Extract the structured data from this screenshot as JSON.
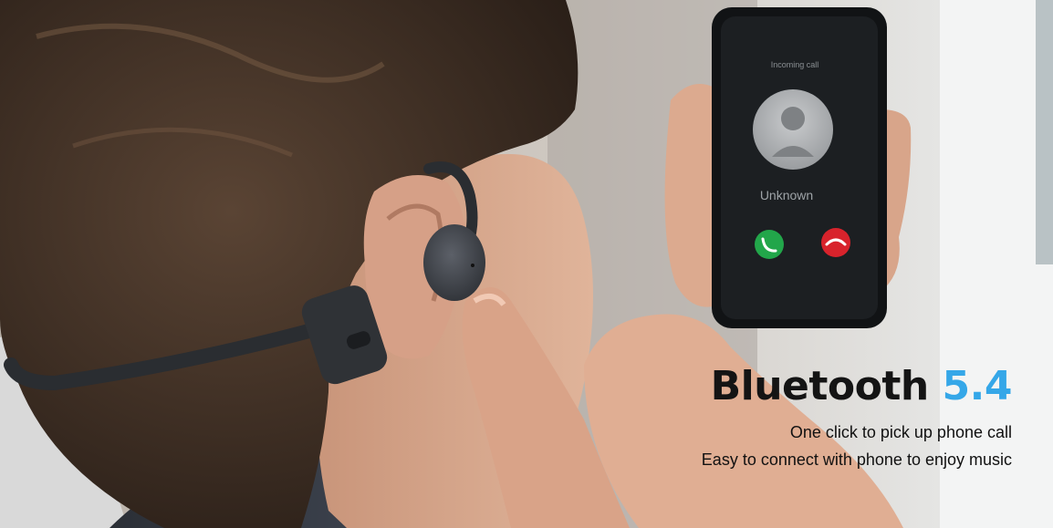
{
  "hero": {
    "title_word": "Bluetooth",
    "title_version": "5.4",
    "line1": "One click to pick up phone call",
    "line2": "Easy to connect with phone to enjoy music"
  },
  "phone_screen": {
    "call_label": "Incoming call",
    "caller_name": "Unknown",
    "answer_icon": "phone-answer-icon",
    "decline_icon": "phone-decline-icon"
  },
  "colors": {
    "accent": "#35a7e8",
    "title": "#141414",
    "answer": "#22a64a",
    "decline": "#d8232c"
  }
}
